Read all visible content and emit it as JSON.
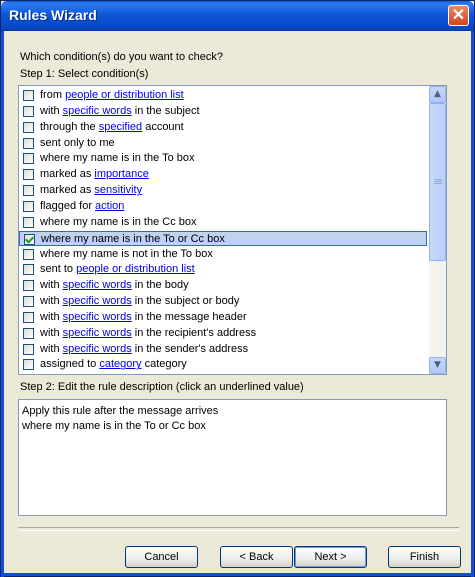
{
  "window": {
    "title": "Rules Wizard",
    "close": "✕"
  },
  "question": "Which condition(s) do you want to check?",
  "step1": "Step 1: Select condition(s)",
  "conditions": [
    {
      "parts": [
        "from ",
        "people or distribution list"
      ],
      "checked": false
    },
    {
      "parts": [
        "with ",
        "specific words",
        " in the subject"
      ],
      "checked": false
    },
    {
      "parts": [
        "through the ",
        "specified",
        " account"
      ],
      "checked": false
    },
    {
      "parts": [
        "sent only to me"
      ],
      "checked": false
    },
    {
      "parts": [
        "where my name is in the To box"
      ],
      "checked": false
    },
    {
      "parts": [
        "marked as ",
        "importance"
      ],
      "checked": false
    },
    {
      "parts": [
        "marked as ",
        "sensitivity"
      ],
      "checked": false
    },
    {
      "parts": [
        "flagged for ",
        "action"
      ],
      "checked": false
    },
    {
      "parts": [
        "where my name is in the Cc box"
      ],
      "checked": false
    },
    {
      "parts": [
        "where my name is in the To or Cc box"
      ],
      "checked": true,
      "selected": true
    },
    {
      "parts": [
        "where my name is not in the To box"
      ],
      "checked": false
    },
    {
      "parts": [
        "sent to ",
        "people or distribution list"
      ],
      "checked": false
    },
    {
      "parts": [
        "with ",
        "specific words",
        " in the body"
      ],
      "checked": false
    },
    {
      "parts": [
        "with ",
        "specific words",
        " in the subject or body"
      ],
      "checked": false
    },
    {
      "parts": [
        "with ",
        "specific words",
        " in the message header"
      ],
      "checked": false
    },
    {
      "parts": [
        "with ",
        "specific words",
        " in the recipient's address"
      ],
      "checked": false
    },
    {
      "parts": [
        "with ",
        "specific words",
        " in the sender's address"
      ],
      "checked": false
    },
    {
      "parts": [
        "assigned to ",
        "category",
        " category"
      ],
      "checked": false
    }
  ],
  "step2": "Step 2: Edit the rule description (click an underlined value)",
  "description": [
    "Apply this rule after the message arrives",
    "where my name is in the To or Cc box"
  ],
  "buttons": {
    "cancel": "Cancel",
    "back": "< Back",
    "next": "Next >",
    "finish": "Finish"
  },
  "scroll": {
    "up": "▲",
    "down": "▼"
  }
}
